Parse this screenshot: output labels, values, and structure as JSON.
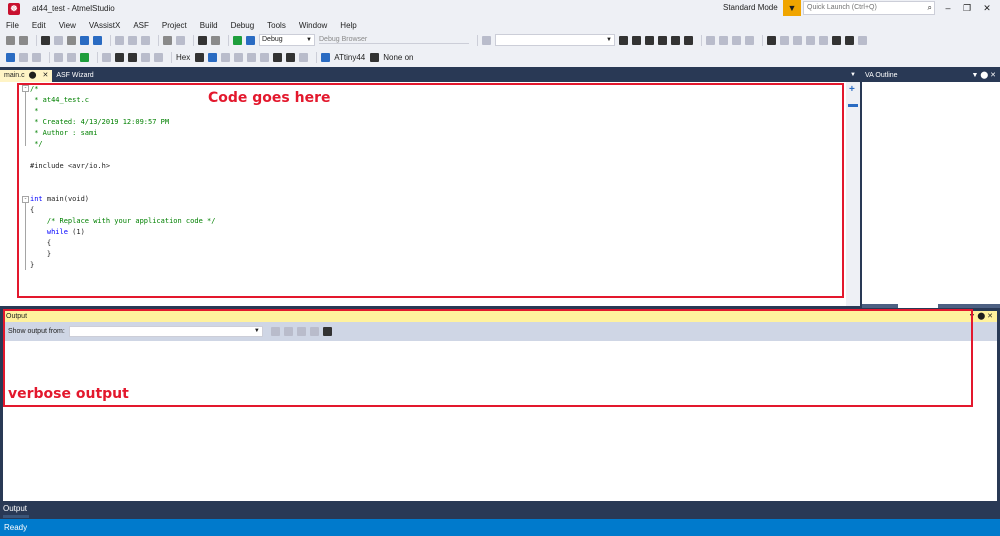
{
  "window": {
    "title": "at44_test - AtmelStudio",
    "mode": "Standard Mode",
    "quick_launch_placeholder": "Quick Launch (Ctrl+Q)"
  },
  "menu": [
    "File",
    "Edit",
    "View",
    "VAssistX",
    "ASF",
    "Project",
    "Build",
    "Debug",
    "Tools",
    "Window",
    "Help"
  ],
  "toolbar": {
    "config": "Debug",
    "debug_browser": "Debug Browser",
    "hex": "Hex",
    "device": "ATtiny44",
    "tool": "None on"
  },
  "tabs": [
    {
      "label": "main.c",
      "active": true
    },
    {
      "label": "ASF Wizard",
      "active": false
    }
  ],
  "editor": {
    "lines": [
      {
        "text": "/*",
        "kind": "comment"
      },
      {
        "text": " * at44_test.c",
        "kind": "comment"
      },
      {
        "text": " *",
        "kind": "comment"
      },
      {
        "text": " * Created: 4/13/2019 12:09:57 PM",
        "kind": "comment"
      },
      {
        "text": " * Author : sami",
        "kind": "comment"
      },
      {
        "text": " */",
        "kind": "comment"
      },
      {
        "text": "",
        "kind": "plain"
      },
      {
        "text": "#include <avr/io.h>",
        "kind": "plain"
      },
      {
        "text": "",
        "kind": "plain"
      },
      {
        "text": "",
        "kind": "plain"
      },
      {
        "text": "int main(void)",
        "kind": "plain"
      },
      {
        "text": "{",
        "kind": "plain"
      },
      {
        "text": "    /* Replace with your application code */",
        "kind": "comment"
      },
      {
        "text": "    while (1)",
        "kind": "plain"
      },
      {
        "text": "    {",
        "kind": "plain"
      },
      {
        "text": "    }",
        "kind": "plain"
      },
      {
        "text": "}",
        "kind": "plain"
      }
    ]
  },
  "va_outline": {
    "title": "VA Outline"
  },
  "output": {
    "title": "Output",
    "show_from_label": "Show output from:",
    "tab_label": "Output"
  },
  "status": {
    "text": "Ready"
  },
  "annotations": {
    "code": "Code goes here",
    "output": "verbose output"
  },
  "colors": {
    "annotation": "#e3182d",
    "status_bar": "#007acc",
    "frame": "#293955",
    "output_header": "#fff29d"
  }
}
